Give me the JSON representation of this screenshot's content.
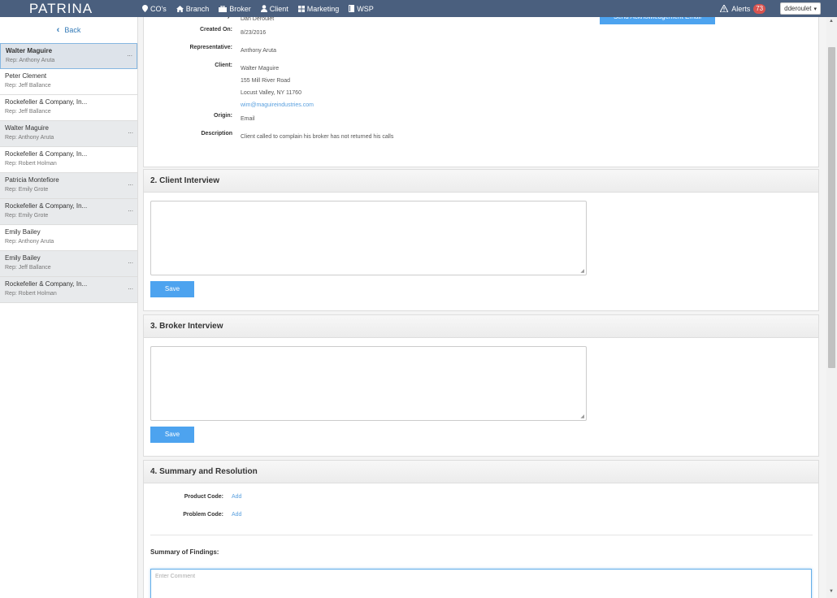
{
  "brand": "PATRINA",
  "nav": {
    "items": [
      {
        "label": "CO's",
        "icon": "map-marker-icon"
      },
      {
        "label": "Branch",
        "icon": "home-icon"
      },
      {
        "label": "Broker",
        "icon": "briefcase-icon"
      },
      {
        "label": "Client",
        "icon": "user-icon"
      },
      {
        "label": "Marketing",
        "icon": "grid-icon"
      },
      {
        "label": "WSP",
        "icon": "book-icon"
      }
    ],
    "alerts_label": "Alerts",
    "alerts_count": "73",
    "user": "dderoulet"
  },
  "sidebar": {
    "back_label": "Back",
    "items": [
      {
        "name": "Walter Maguire",
        "rep": "Rep: Anthony Aruta",
        "dots": "..."
      },
      {
        "name": "Peter Clement",
        "rep": "Rep: Jeff Ballance",
        "dots": ""
      },
      {
        "name": "Rockefeller & Company, In...",
        "rep": "Rep: Jeff Ballance",
        "dots": ""
      },
      {
        "name": "Walter Maguire",
        "rep": "Rep: Anthony Aruta",
        "dots": "..."
      },
      {
        "name": "Rockefeller & Company, In...",
        "rep": "Rep: Robert Holman",
        "dots": ""
      },
      {
        "name": "Patricia Montefiore",
        "rep": "Rep: Emily Grote",
        "dots": "..."
      },
      {
        "name": "Rockefeller & Company, In...",
        "rep": "Rep: Emily Grote",
        "dots": "..."
      },
      {
        "name": "Emily Bailey",
        "rep": "Rep: Anthony Aruta",
        "dots": ""
      },
      {
        "name": "Emily Bailey",
        "rep": "Rep: Jeff Ballance",
        "dots": "..."
      },
      {
        "name": "Rockefeller & Company, In...",
        "rep": "Rep: Robert Holman",
        "dots": "..."
      }
    ]
  },
  "details": {
    "created_by_label": "Created By:",
    "created_by": "Dan Deroulet",
    "created_on_label": "Created On:",
    "created_on": "8/23/2016",
    "rep_label": "Representative:",
    "rep": "Anthony Aruta",
    "client_label": "Client:",
    "client_name": "Walter Maguire",
    "client_addr1": "155 Mill River Road",
    "client_addr2": "Locust Valley, NY 11760",
    "client_email": "wim@maguireindustries.com",
    "origin_label": "Origin:",
    "origin": "Email",
    "description_label": "Description",
    "description": "Client called to complain his broker has not returned his calls",
    "ack_button": "Send Acknowledgement Email"
  },
  "client_interview": {
    "title": "2. Client Interview",
    "save": "Save"
  },
  "broker_interview": {
    "title": "3. Broker Interview",
    "save": "Save"
  },
  "summary": {
    "title": "4. Summary and Resolution",
    "product_code_label": "Product Code:",
    "product_code_action": "Add",
    "problem_code_label": "Problem Code:",
    "problem_code_action": "Add",
    "findings_label": "Summary of Findings:",
    "comment_placeholder": "Enter Comment"
  }
}
